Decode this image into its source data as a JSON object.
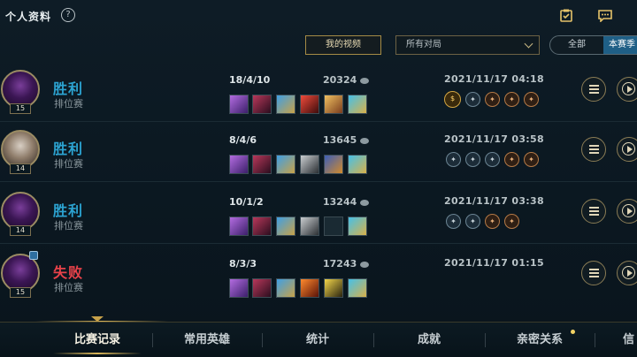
{
  "header": {
    "title": "个人资料",
    "help_glyph": "?",
    "icons": [
      "clipboard-check-icon",
      "chat-bubble-icon"
    ]
  },
  "filters": {
    "my_videos_label": "我的视频",
    "match_filter_value": "所有对局",
    "segment_all": "全部",
    "segment_season": "本赛季"
  },
  "matches": [
    {
      "result": "胜利",
      "mode": "排位赛",
      "level": "15",
      "kda": "18/4/10",
      "gold": "20324",
      "date": "2021/11/17 04:18",
      "items": [
        "purple-claw",
        "crimson-blade",
        "blue-gold-sword",
        "red-dark-relic",
        "golden-armor",
        "sword-cross"
      ],
      "medals": [
        "gold-medal",
        "blue-medal",
        "bronze-medal",
        "bronze-medal",
        "bronze-medal"
      ]
    },
    {
      "result": "胜利",
      "mode": "排位赛",
      "level": "14",
      "kda": "8/4/6",
      "gold": "13645",
      "date": "2021/11/17 03:58",
      "items": [
        "purple-claw",
        "crimson-blade",
        "blue-gold-sword",
        "steel-blades",
        "blue-shield",
        "sword-cross"
      ],
      "medals": [
        "blue-medal",
        "blue-medal",
        "blue-medal",
        "bronze-medal",
        "bronze-medal"
      ]
    },
    {
      "result": "胜利",
      "mode": "排位赛",
      "level": "14",
      "kda": "10/1/2",
      "gold": "13244",
      "date": "2021/11/17 03:38",
      "items": [
        "purple-claw",
        "crimson-blade",
        "blue-gold-sword",
        "steel-blades",
        "empty-slot",
        "sword-cross"
      ],
      "medals": [
        "blue-medal",
        "blue-medal",
        "bronze-medal",
        "bronze-medal"
      ]
    },
    {
      "result": "失败",
      "mode": "排位赛",
      "level": "15",
      "kda": "8/3/3",
      "gold": "17243",
      "date": "2021/11/17 01:15",
      "items": [
        "purple-claw",
        "crimson-blade",
        "blue-gold-sword",
        "fire-blade",
        "yellow-triangle",
        "sword-cross"
      ],
      "medals": []
    }
  ],
  "nav": {
    "tabs": [
      "比赛记录",
      "常用英雄",
      "统计",
      "成就",
      "亲密关系",
      "信"
    ]
  }
}
